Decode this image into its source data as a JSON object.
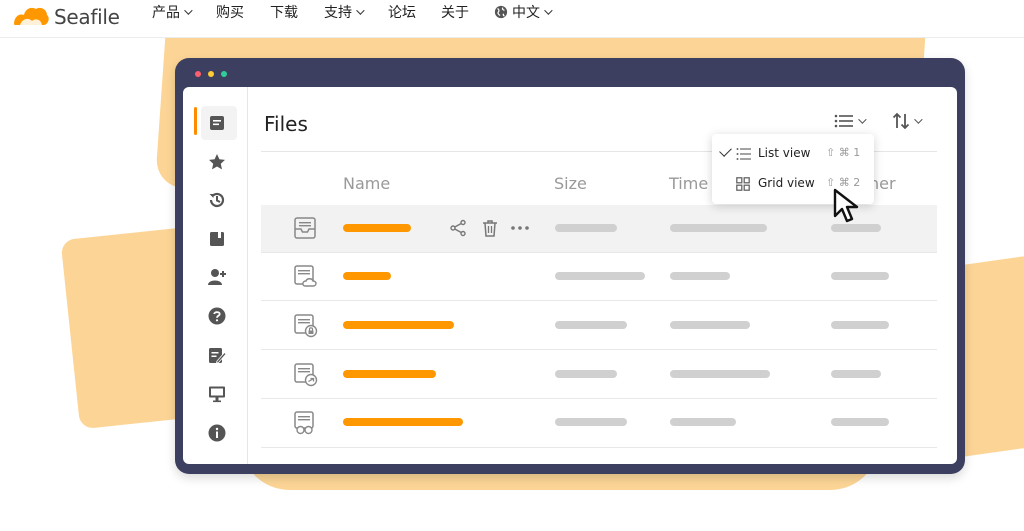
{
  "brand": {
    "logo_text": "Seafile",
    "accent": "#ff9800",
    "window_color": "#3c3f5f",
    "blob_color": "#fcd596"
  },
  "nav": {
    "items": [
      {
        "label": "产品",
        "has_dropdown": true
      },
      {
        "label": "购买",
        "has_dropdown": false
      },
      {
        "label": "下载",
        "has_dropdown": false
      },
      {
        "label": "支持",
        "has_dropdown": true
      },
      {
        "label": "论坛",
        "has_dropdown": false
      },
      {
        "label": "关于",
        "has_dropdown": false
      }
    ],
    "language": {
      "label": "中文",
      "icon": "globe-icon"
    }
  },
  "window": {
    "dots": [
      "#ff5f6d",
      "#ffcc33",
      "#33cc99"
    ],
    "sidebar": {
      "items": [
        {
          "icon": "files-icon",
          "active": true
        },
        {
          "icon": "star-icon"
        },
        {
          "icon": "history-icon"
        },
        {
          "icon": "library-icon"
        },
        {
          "icon": "add-user-icon"
        },
        {
          "icon": "help-icon"
        },
        {
          "icon": "edit-doc-icon"
        },
        {
          "icon": "monitor-icon"
        },
        {
          "icon": "info-icon"
        }
      ]
    },
    "title": "Files",
    "toolbar": {
      "view_icon": "list-view-icon",
      "sort_icon": "sort-icon"
    },
    "columns": [
      "Name",
      "Size",
      "Time",
      "ner"
    ],
    "rows": [
      {
        "icon": "inbox-file-icon",
        "highlighted": true,
        "name_fill": 0.45,
        "size_fill": 0.62,
        "time_fill": 0.97,
        "owner_fill": 0.5,
        "actions": [
          "share-icon",
          "trash-icon",
          "more-icon"
        ]
      },
      {
        "icon": "cloud-file-icon",
        "highlighted": false,
        "name_fill": 0.32,
        "size_fill": 0.9,
        "time_fill": 0.6,
        "owner_fill": 0.58
      },
      {
        "icon": "locked-file-icon",
        "highlighted": false,
        "name_fill": 0.74,
        "size_fill": 0.72,
        "time_fill": 0.8,
        "owner_fill": 0.58
      },
      {
        "icon": "shared-file-icon",
        "highlighted": false,
        "name_fill": 0.62,
        "size_fill": 0.62,
        "time_fill": 1.0,
        "owner_fill": 0.5
      },
      {
        "icon": "group-file-icon",
        "highlighted": false,
        "name_fill": 0.8,
        "size_fill": 0.72,
        "time_fill": 0.66,
        "owner_fill": 0.58
      }
    ],
    "view_menu": {
      "items": [
        {
          "label": "List view",
          "shortcut": "⇧ ⌘ 1",
          "checked": true,
          "icon": "list-view-icon"
        },
        {
          "label": "Grid view",
          "shortcut": "⇧ ⌘ 2",
          "checked": false,
          "icon": "grid-view-icon"
        }
      ]
    }
  }
}
